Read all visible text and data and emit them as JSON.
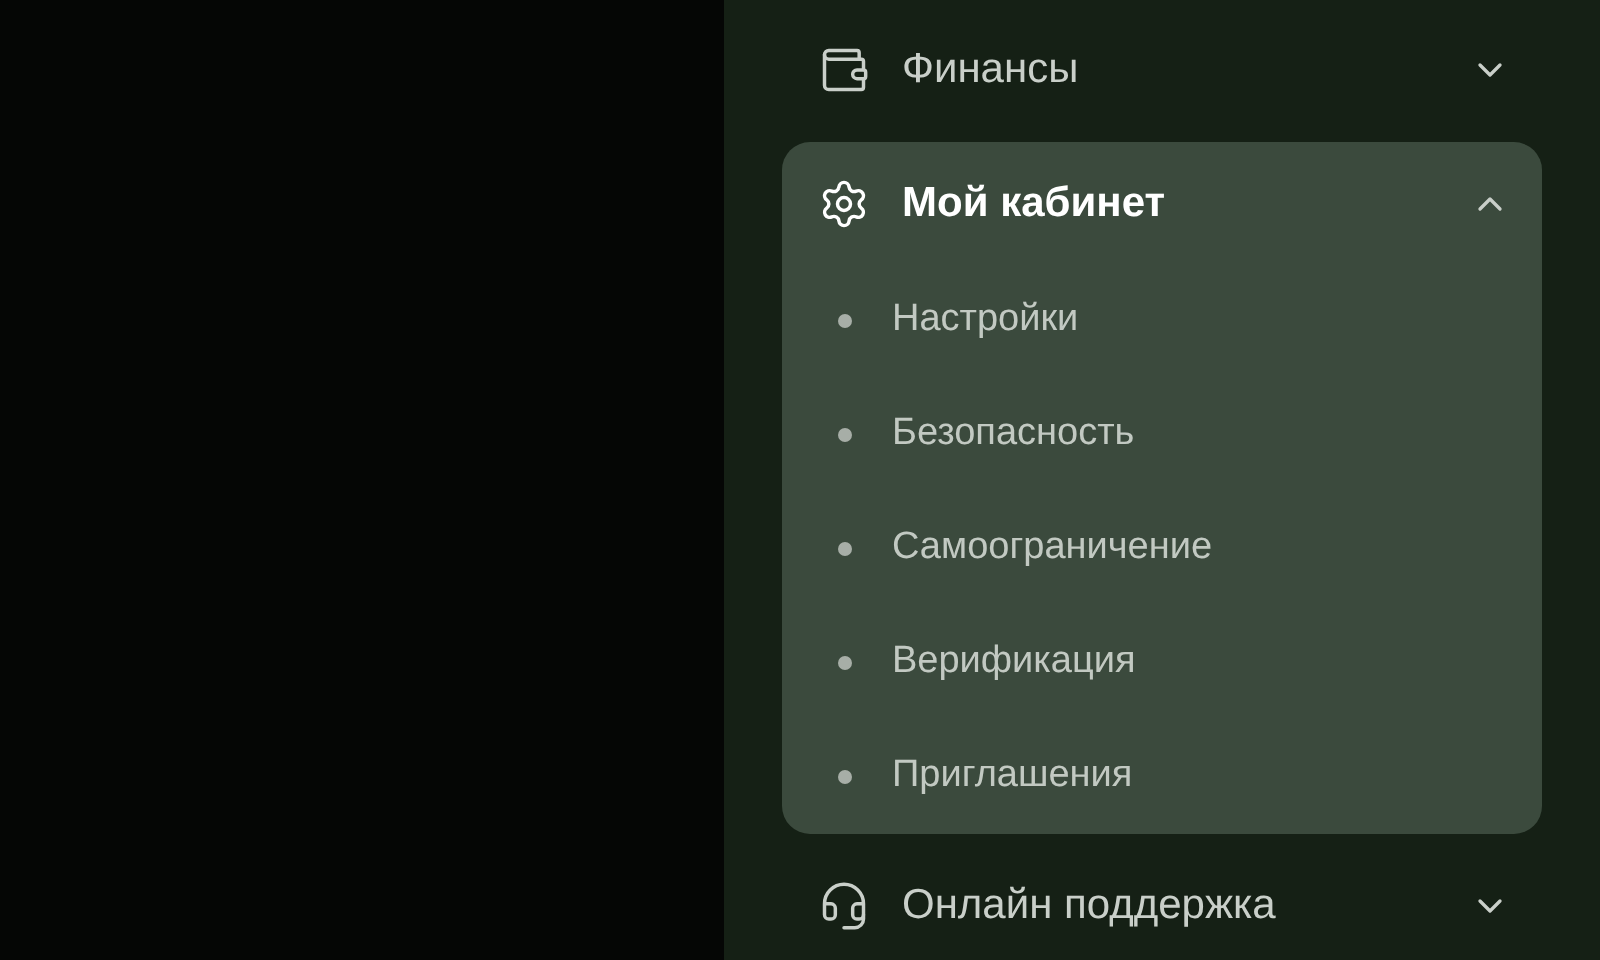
{
  "menu": [
    {
      "kind": "wallet",
      "label": "Финансы",
      "expanded": false
    },
    {
      "kind": "gear",
      "label": "Мой кабинет",
      "expanded": true,
      "children": [
        {
          "label": "Настройки"
        },
        {
          "label": "Безопасность"
        },
        {
          "label": "Самоограничение"
        },
        {
          "label": "Верификация"
        },
        {
          "label": "Приглашения"
        }
      ]
    },
    {
      "kind": "headset",
      "label": "Онлайн поддержка",
      "expanded": false
    }
  ]
}
